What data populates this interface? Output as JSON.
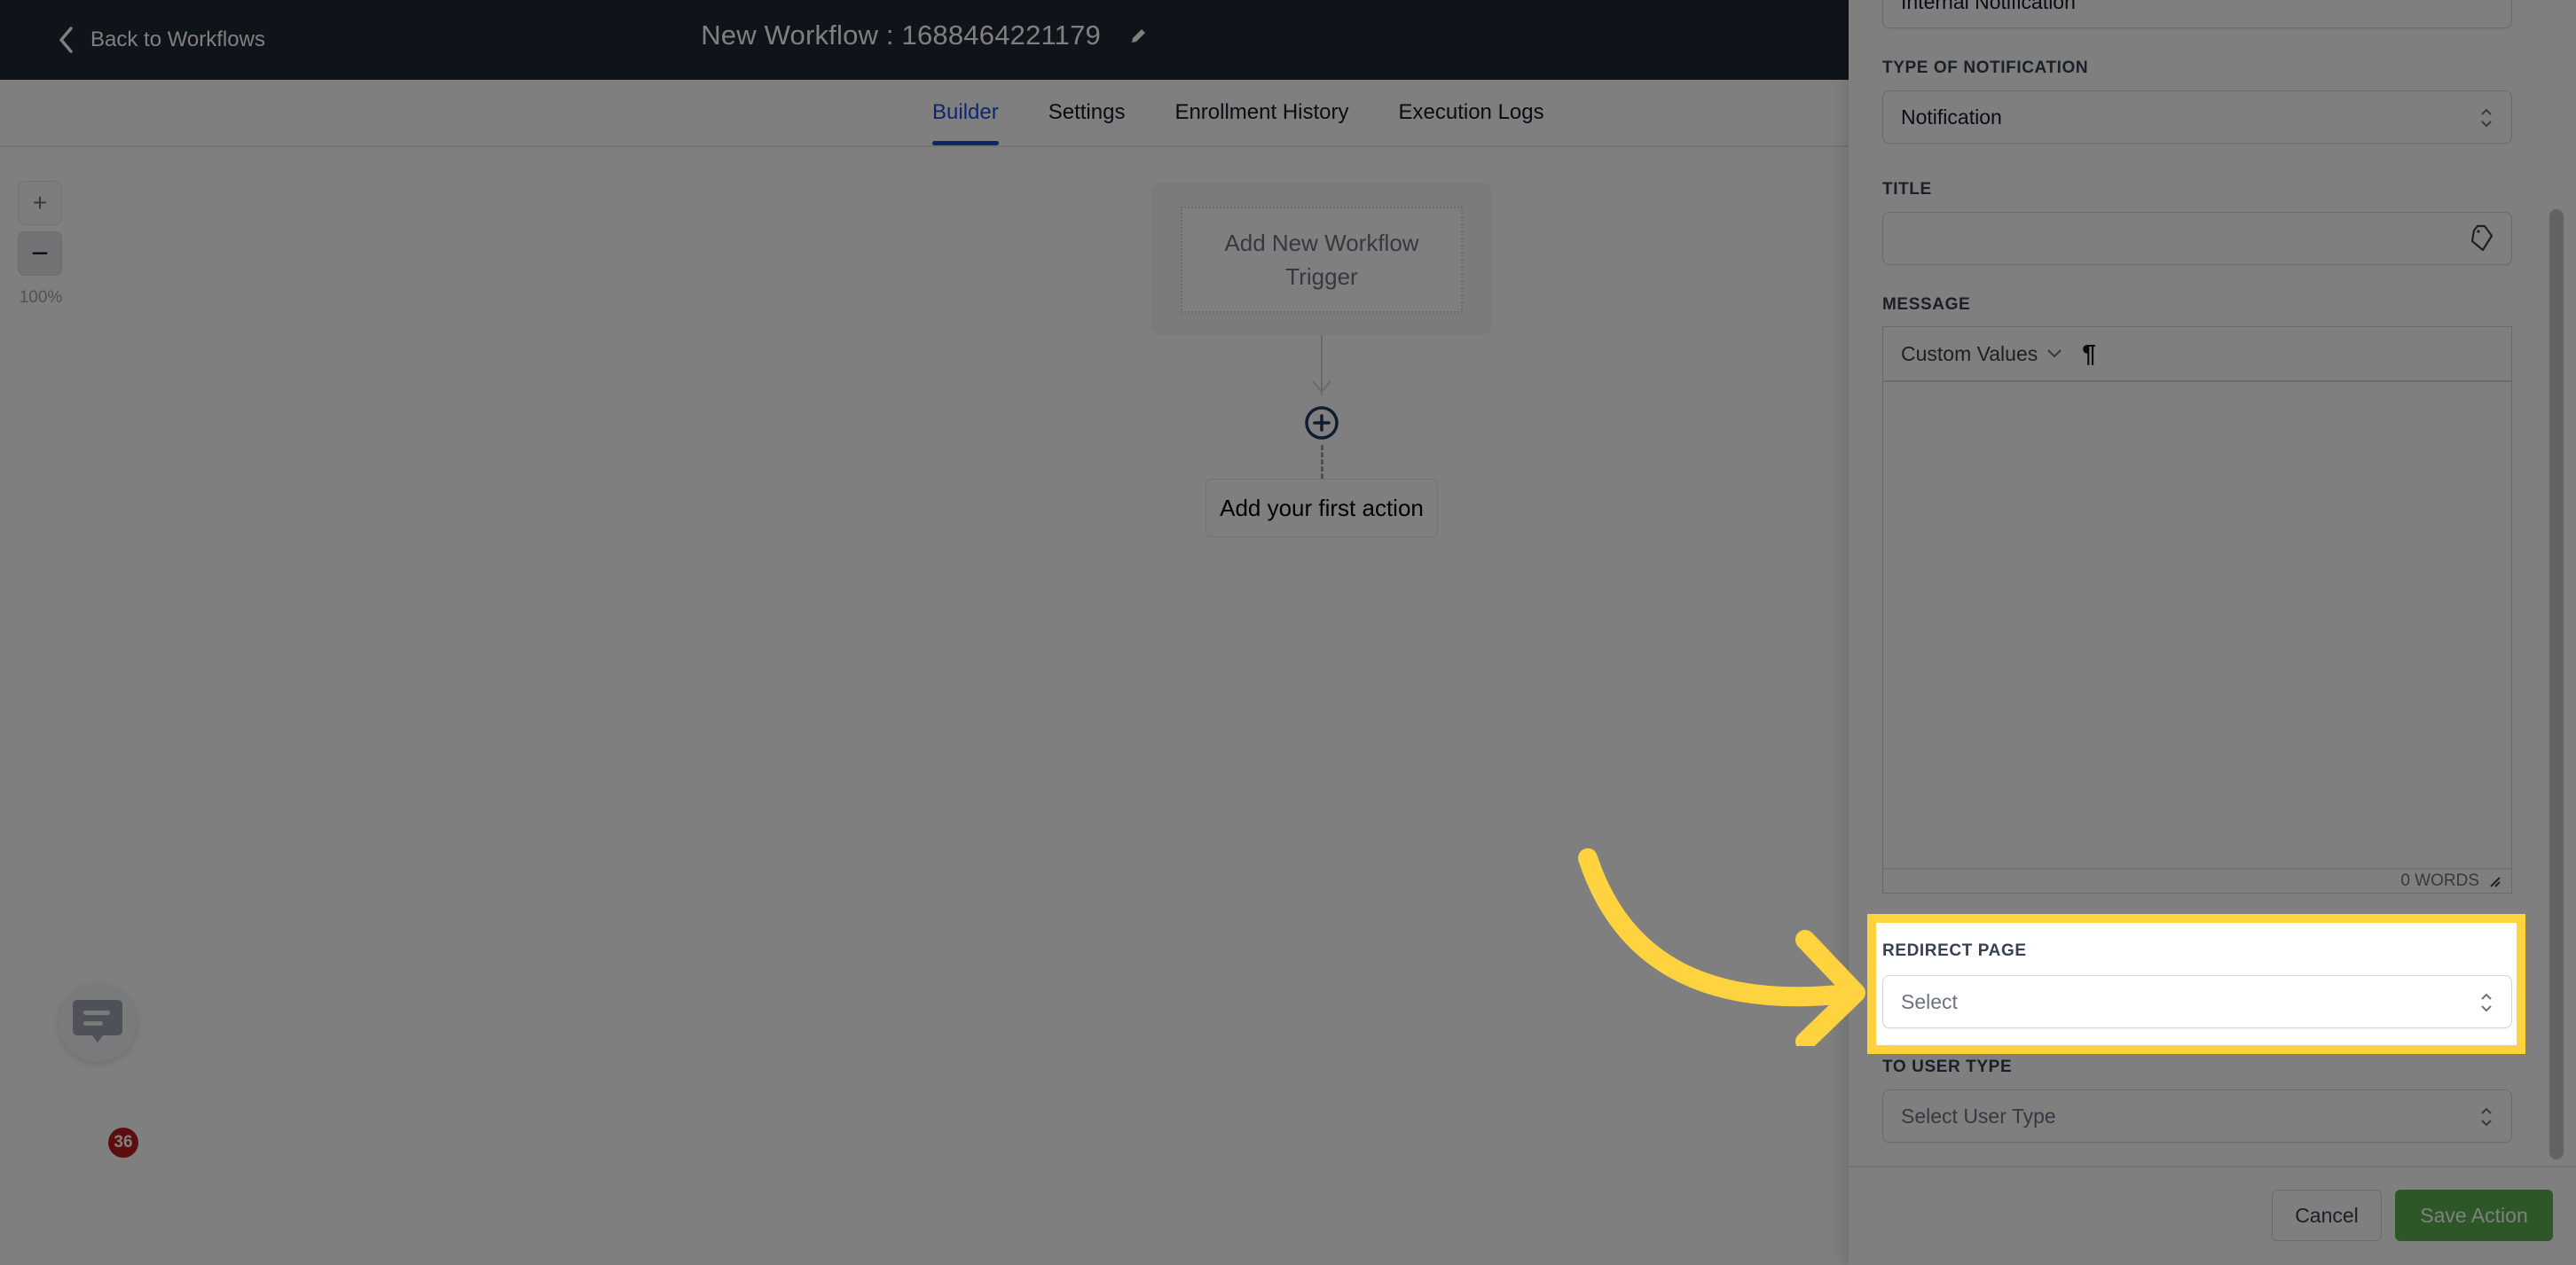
{
  "header": {
    "back_label": "Back to Workflows",
    "workflow_title": "New Workflow : 1688464221179"
  },
  "tabs": [
    {
      "label": "Builder",
      "active": true
    },
    {
      "label": "Settings",
      "active": false
    },
    {
      "label": "Enrollment History",
      "active": false
    },
    {
      "label": "Execution Logs",
      "active": false
    }
  ],
  "canvas": {
    "zoom_in_label": "+",
    "zoom_out_label": "−",
    "zoom_level": "100%",
    "trigger_label": "Add New Workflow Trigger",
    "first_action_label": "Add your first action"
  },
  "chat_widget": {
    "badge_count": "36"
  },
  "panel": {
    "action_name_value": "Internal Notification",
    "type_label": "Type of Notification",
    "type_value": "Notification",
    "title_label": "Title",
    "title_value": "",
    "message_label": "Message",
    "custom_values_label": "Custom Values",
    "word_count": "0 WORDS",
    "redirect_label": "Redirect Page",
    "redirect_placeholder": "Select",
    "user_type_label": "To User Type",
    "user_type_placeholder": "Select User Type",
    "cancel_label": "Cancel",
    "save_label": "Save Action"
  },
  "annotation": {
    "highlight_color": "#ffd23f",
    "highlight_target": "Redirect Page"
  },
  "colors": {
    "header_bg": "#1f2937",
    "accent": "#1d4ed8",
    "save_button": "#5cae4f",
    "badge": "#b91c1c"
  }
}
